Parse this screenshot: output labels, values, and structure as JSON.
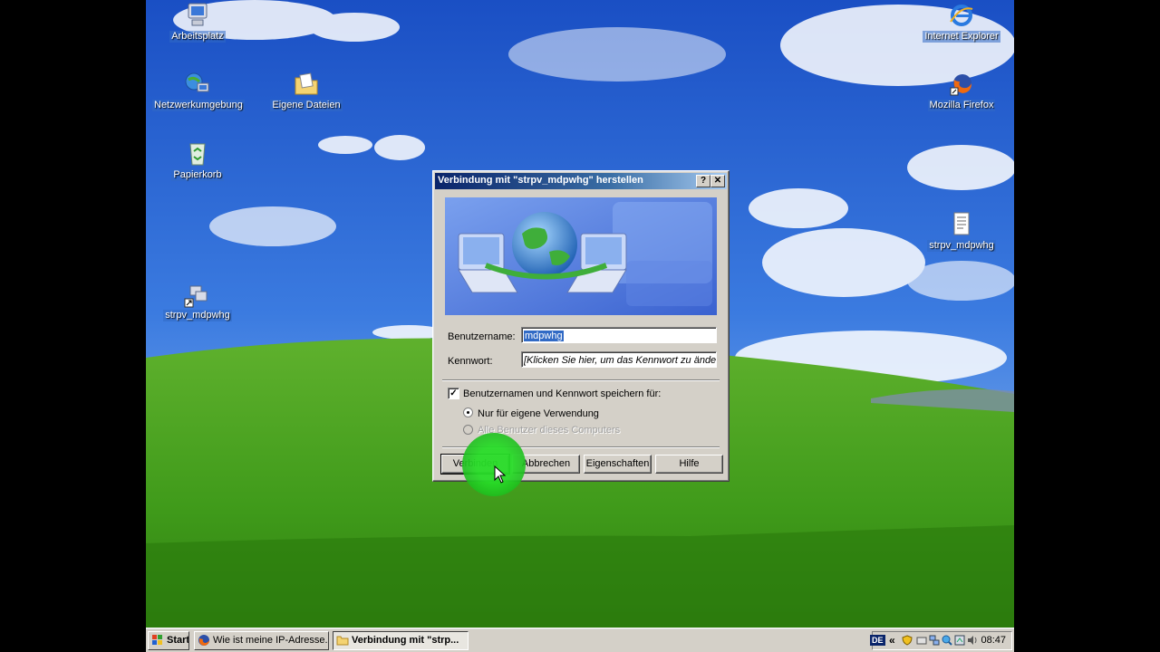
{
  "desktop": {
    "icons": [
      {
        "label": "Arbeitsplatz"
      },
      {
        "label": "Netzwerkumgebung"
      },
      {
        "label": "Eigene Dateien"
      },
      {
        "label": "Papierkorb"
      },
      {
        "label": "strpv_mdpwhg"
      },
      {
        "label": "Internet Explorer"
      },
      {
        "label": "Mozilla Firefox"
      },
      {
        "label": "strpv_mdpwhg"
      }
    ]
  },
  "dialog": {
    "title": "Verbindung mit \"strpv_mdpwhg\" herstellen",
    "help_btn": "?",
    "close_btn": "✕",
    "username_label": "Benutzername:",
    "username_value": "mdpwhg",
    "password_label": "Kennwort:",
    "password_placeholder": "[Klicken Sie hier, um das Kennwort zu ändern]",
    "save_checkbox_label": "Benutzernamen und Kennwort speichern für:",
    "save_checked": true,
    "radio_own": "Nur für eigene Verwendung",
    "radio_all": "Alle Benutzer dieses Computers",
    "buttons": {
      "connect": "Verbinden",
      "cancel": "Abbrechen",
      "properties": "Eigenschaften",
      "help": "Hilfe"
    }
  },
  "taskbar": {
    "start": "Start",
    "tasks": [
      {
        "label": "Wie ist meine IP-Adresse...",
        "active": false
      },
      {
        "label": "Verbindung mit \"strp...",
        "active": true
      }
    ],
    "tray": {
      "language": "DE",
      "expand": "«",
      "clock": "08:47"
    }
  }
}
